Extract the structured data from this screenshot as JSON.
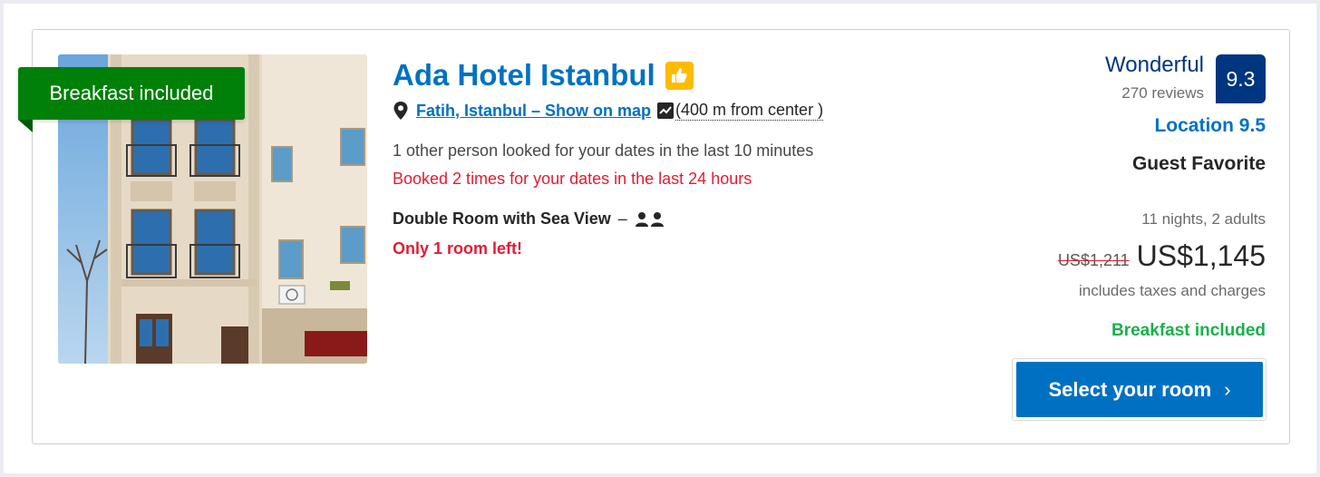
{
  "badge": {
    "ribbon_label": "Breakfast included"
  },
  "hotel": {
    "name": "Ada Hotel Istanbul",
    "location_link": "Fatih, Istanbul – Show on map",
    "distance": "(400 m from center )",
    "looked_text": "1 other person looked for your dates in the last 10 minutes",
    "booked_text": "Booked 2 times for your dates in the last 24 hours",
    "room_type": "Double Room with Sea View",
    "room_dash": "–",
    "rooms_left": "Only 1 room left!"
  },
  "rating": {
    "word": "Wonderful",
    "reviews": "270 reviews",
    "score": "9.3",
    "location_score": "Location 9.5",
    "guest_favorite": "Guest Favorite"
  },
  "price": {
    "stay": "11 nights, 2 adults",
    "old": "US$1,211",
    "new": "US$1,145",
    "taxes": "includes taxes and charges",
    "breakfast": "Breakfast included"
  },
  "cta": {
    "label": "Select your room",
    "chevron": "›"
  },
  "icons": {
    "pin": "map-pin-icon",
    "map": "map-icon",
    "thumbs": "thumbs-up-icon",
    "people": "two-people-icon"
  },
  "colors": {
    "brand_blue": "#0071c2",
    "dark_blue": "#003580",
    "ribbon_green": "#008009",
    "breakfast_green": "#1ab04c",
    "alert_red": "#e21c32",
    "genius_yellow": "#febb02"
  }
}
